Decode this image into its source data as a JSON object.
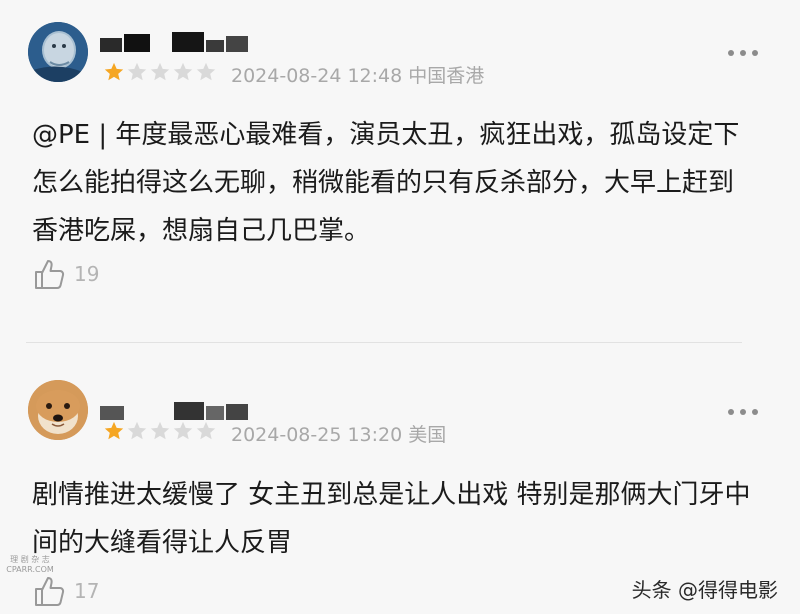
{
  "reviews": [
    {
      "rating": 1,
      "max_rating": 5,
      "date": "2024-08-24 12:48",
      "location": "中国香港",
      "text": "@PE | 年度最恶心最难看，演员太丑，疯狂出戏，孤岛设定下怎么能拍得这么无聊，稍微能看的只有反杀部分，大早上赶到香港吃屎，想扇自己几巴掌。",
      "likes": "19"
    },
    {
      "rating": 1,
      "max_rating": 5,
      "date": "2024-08-25 13:20",
      "location": "美国",
      "text": "剧情推进太缓慢了 女主丑到总是让人出戏 特别是那俩大门牙中间的大缝看得让人反胃",
      "likes": "17"
    }
  ],
  "icons": {
    "star_filled": "star-filled-icon",
    "star_empty": "star-empty-icon",
    "more": "more-dots-icon",
    "like": "thumbs-up-icon"
  },
  "colors": {
    "star_filled": "#f5a623",
    "star_empty": "#d9d9d9",
    "meta_text": "#a8a8a8",
    "background": "#f7f7f7"
  },
  "watermark": {
    "left_top": "理 剧 杂 志",
    "left_bottom": "CPARR.COM",
    "right": "头条 @得得电影"
  }
}
